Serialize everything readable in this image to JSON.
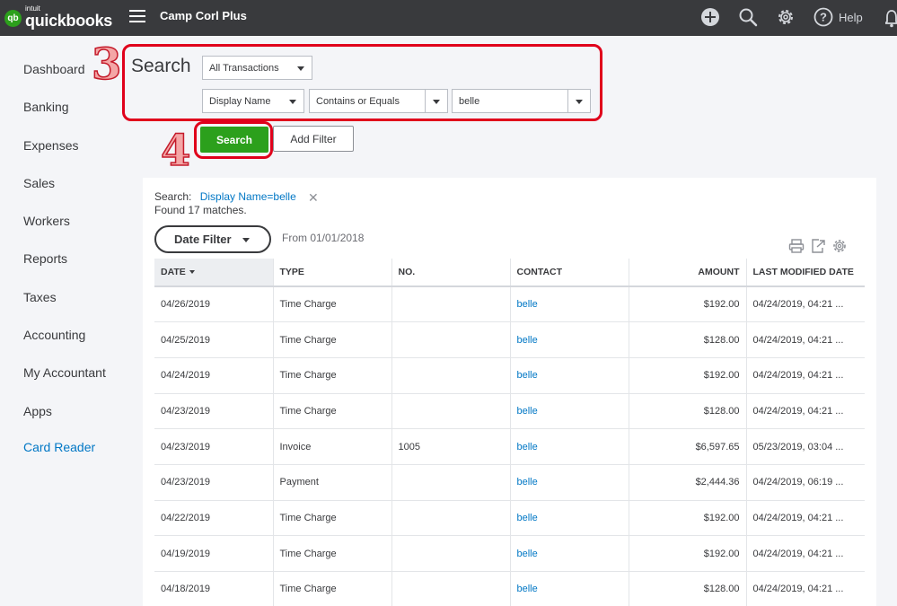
{
  "app": {
    "logo_intuit": "intuit",
    "logo_name": "quickbooks",
    "logo_badge": "qb",
    "company": "Camp Corl Plus",
    "help_label": "Help",
    "icons": [
      "plus-circle-icon",
      "search-icon",
      "gear-icon",
      "help-icon",
      "bell-icon"
    ]
  },
  "sidebar": {
    "items": [
      {
        "label": "Dashboard"
      },
      {
        "label": "Banking"
      },
      {
        "label": "Expenses"
      },
      {
        "label": "Sales"
      },
      {
        "label": "Workers"
      },
      {
        "label": "Reports"
      },
      {
        "label": "Taxes"
      },
      {
        "label": "Accounting"
      },
      {
        "label": "My Accountant"
      },
      {
        "label": "Apps"
      },
      {
        "label": "Card Reader"
      }
    ]
  },
  "search": {
    "title": "Search",
    "transaction_type": "All Transactions",
    "field": "Display Name",
    "operator": "Contains or Equals",
    "value": "belle",
    "search_button": "Search",
    "add_filter_button": "Add Filter"
  },
  "annotations": {
    "step3": "3",
    "step4": "4",
    "color": "#e0001b"
  },
  "results": {
    "criteria_label": "Search:",
    "criteria_value": "Display Name=belle",
    "found": "Found 17 matches.",
    "date_filter_label": "Date Filter",
    "from_text": "From 01/01/2018",
    "columns": {
      "date": "DATE",
      "type": "TYPE",
      "no": "NO.",
      "contact": "CONTACT",
      "amount": "AMOUNT",
      "modified": "LAST MODIFIED DATE"
    },
    "rows": [
      {
        "date": "04/26/2019",
        "type": "Time Charge",
        "no": "",
        "contact": "belle",
        "amount": "$192.00",
        "modified": "04/24/2019, 04:21 ..."
      },
      {
        "date": "04/25/2019",
        "type": "Time Charge",
        "no": "",
        "contact": "belle",
        "amount": "$128.00",
        "modified": "04/24/2019, 04:21 ..."
      },
      {
        "date": "04/24/2019",
        "type": "Time Charge",
        "no": "",
        "contact": "belle",
        "amount": "$192.00",
        "modified": "04/24/2019, 04:21 ..."
      },
      {
        "date": "04/23/2019",
        "type": "Time Charge",
        "no": "",
        "contact": "belle",
        "amount": "$128.00",
        "modified": "04/24/2019, 04:21 ..."
      },
      {
        "date": "04/23/2019",
        "type": "Invoice",
        "no": "1005",
        "contact": "belle",
        "amount": "$6,597.65",
        "modified": "05/23/2019, 03:04 ..."
      },
      {
        "date": "04/23/2019",
        "type": "Payment",
        "no": "",
        "contact": "belle",
        "amount": "$2,444.36",
        "modified": "04/24/2019, 06:19 ..."
      },
      {
        "date": "04/22/2019",
        "type": "Time Charge",
        "no": "",
        "contact": "belle",
        "amount": "$192.00",
        "modified": "04/24/2019, 04:21 ..."
      },
      {
        "date": "04/19/2019",
        "type": "Time Charge",
        "no": "",
        "contact": "belle",
        "amount": "$192.00",
        "modified": "04/24/2019, 04:21 ..."
      },
      {
        "date": "04/18/2019",
        "type": "Time Charge",
        "no": "",
        "contact": "belle",
        "amount": "$128.00",
        "modified": "04/24/2019, 04:21 ..."
      }
    ]
  }
}
